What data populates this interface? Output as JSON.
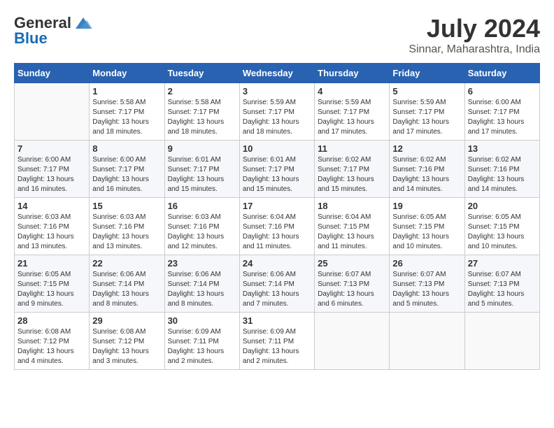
{
  "header": {
    "logo_general": "General",
    "logo_blue": "Blue",
    "title": "July 2024",
    "subtitle": "Sinnar, Maharashtra, India"
  },
  "weekdays": [
    "Sunday",
    "Monday",
    "Tuesday",
    "Wednesday",
    "Thursday",
    "Friday",
    "Saturday"
  ],
  "weeks": [
    [
      {
        "day": "",
        "sunrise": "",
        "sunset": "",
        "daylight": ""
      },
      {
        "day": "1",
        "sunrise": "Sunrise: 5:58 AM",
        "sunset": "Sunset: 7:17 PM",
        "daylight": "Daylight: 13 hours and 18 minutes."
      },
      {
        "day": "2",
        "sunrise": "Sunrise: 5:58 AM",
        "sunset": "Sunset: 7:17 PM",
        "daylight": "Daylight: 13 hours and 18 minutes."
      },
      {
        "day": "3",
        "sunrise": "Sunrise: 5:59 AM",
        "sunset": "Sunset: 7:17 PM",
        "daylight": "Daylight: 13 hours and 18 minutes."
      },
      {
        "day": "4",
        "sunrise": "Sunrise: 5:59 AM",
        "sunset": "Sunset: 7:17 PM",
        "daylight": "Daylight: 13 hours and 17 minutes."
      },
      {
        "day": "5",
        "sunrise": "Sunrise: 5:59 AM",
        "sunset": "Sunset: 7:17 PM",
        "daylight": "Daylight: 13 hours and 17 minutes."
      },
      {
        "day": "6",
        "sunrise": "Sunrise: 6:00 AM",
        "sunset": "Sunset: 7:17 PM",
        "daylight": "Daylight: 13 hours and 17 minutes."
      }
    ],
    [
      {
        "day": "7",
        "sunrise": "Sunrise: 6:00 AM",
        "sunset": "Sunset: 7:17 PM",
        "daylight": "Daylight: 13 hours and 16 minutes."
      },
      {
        "day": "8",
        "sunrise": "Sunrise: 6:00 AM",
        "sunset": "Sunset: 7:17 PM",
        "daylight": "Daylight: 13 hours and 16 minutes."
      },
      {
        "day": "9",
        "sunrise": "Sunrise: 6:01 AM",
        "sunset": "Sunset: 7:17 PM",
        "daylight": "Daylight: 13 hours and 15 minutes."
      },
      {
        "day": "10",
        "sunrise": "Sunrise: 6:01 AM",
        "sunset": "Sunset: 7:17 PM",
        "daylight": "Daylight: 13 hours and 15 minutes."
      },
      {
        "day": "11",
        "sunrise": "Sunrise: 6:02 AM",
        "sunset": "Sunset: 7:17 PM",
        "daylight": "Daylight: 13 hours and 15 minutes."
      },
      {
        "day": "12",
        "sunrise": "Sunrise: 6:02 AM",
        "sunset": "Sunset: 7:16 PM",
        "daylight": "Daylight: 13 hours and 14 minutes."
      },
      {
        "day": "13",
        "sunrise": "Sunrise: 6:02 AM",
        "sunset": "Sunset: 7:16 PM",
        "daylight": "Daylight: 13 hours and 14 minutes."
      }
    ],
    [
      {
        "day": "14",
        "sunrise": "Sunrise: 6:03 AM",
        "sunset": "Sunset: 7:16 PM",
        "daylight": "Daylight: 13 hours and 13 minutes."
      },
      {
        "day": "15",
        "sunrise": "Sunrise: 6:03 AM",
        "sunset": "Sunset: 7:16 PM",
        "daylight": "Daylight: 13 hours and 13 minutes."
      },
      {
        "day": "16",
        "sunrise": "Sunrise: 6:03 AM",
        "sunset": "Sunset: 7:16 PM",
        "daylight": "Daylight: 13 hours and 12 minutes."
      },
      {
        "day": "17",
        "sunrise": "Sunrise: 6:04 AM",
        "sunset": "Sunset: 7:16 PM",
        "daylight": "Daylight: 13 hours and 11 minutes."
      },
      {
        "day": "18",
        "sunrise": "Sunrise: 6:04 AM",
        "sunset": "Sunset: 7:15 PM",
        "daylight": "Daylight: 13 hours and 11 minutes."
      },
      {
        "day": "19",
        "sunrise": "Sunrise: 6:05 AM",
        "sunset": "Sunset: 7:15 PM",
        "daylight": "Daylight: 13 hours and 10 minutes."
      },
      {
        "day": "20",
        "sunrise": "Sunrise: 6:05 AM",
        "sunset": "Sunset: 7:15 PM",
        "daylight": "Daylight: 13 hours and 10 minutes."
      }
    ],
    [
      {
        "day": "21",
        "sunrise": "Sunrise: 6:05 AM",
        "sunset": "Sunset: 7:15 PM",
        "daylight": "Daylight: 13 hours and 9 minutes."
      },
      {
        "day": "22",
        "sunrise": "Sunrise: 6:06 AM",
        "sunset": "Sunset: 7:14 PM",
        "daylight": "Daylight: 13 hours and 8 minutes."
      },
      {
        "day": "23",
        "sunrise": "Sunrise: 6:06 AM",
        "sunset": "Sunset: 7:14 PM",
        "daylight": "Daylight: 13 hours and 8 minutes."
      },
      {
        "day": "24",
        "sunrise": "Sunrise: 6:06 AM",
        "sunset": "Sunset: 7:14 PM",
        "daylight": "Daylight: 13 hours and 7 minutes."
      },
      {
        "day": "25",
        "sunrise": "Sunrise: 6:07 AM",
        "sunset": "Sunset: 7:13 PM",
        "daylight": "Daylight: 13 hours and 6 minutes."
      },
      {
        "day": "26",
        "sunrise": "Sunrise: 6:07 AM",
        "sunset": "Sunset: 7:13 PM",
        "daylight": "Daylight: 13 hours and 5 minutes."
      },
      {
        "day": "27",
        "sunrise": "Sunrise: 6:07 AM",
        "sunset": "Sunset: 7:13 PM",
        "daylight": "Daylight: 13 hours and 5 minutes."
      }
    ],
    [
      {
        "day": "28",
        "sunrise": "Sunrise: 6:08 AM",
        "sunset": "Sunset: 7:12 PM",
        "daylight": "Daylight: 13 hours and 4 minutes."
      },
      {
        "day": "29",
        "sunrise": "Sunrise: 6:08 AM",
        "sunset": "Sunset: 7:12 PM",
        "daylight": "Daylight: 13 hours and 3 minutes."
      },
      {
        "day": "30",
        "sunrise": "Sunrise: 6:09 AM",
        "sunset": "Sunset: 7:11 PM",
        "daylight": "Daylight: 13 hours and 2 minutes."
      },
      {
        "day": "31",
        "sunrise": "Sunrise: 6:09 AM",
        "sunset": "Sunset: 7:11 PM",
        "daylight": "Daylight: 13 hours and 2 minutes."
      },
      {
        "day": "",
        "sunrise": "",
        "sunset": "",
        "daylight": ""
      },
      {
        "day": "",
        "sunrise": "",
        "sunset": "",
        "daylight": ""
      },
      {
        "day": "",
        "sunrise": "",
        "sunset": "",
        "daylight": ""
      }
    ]
  ]
}
